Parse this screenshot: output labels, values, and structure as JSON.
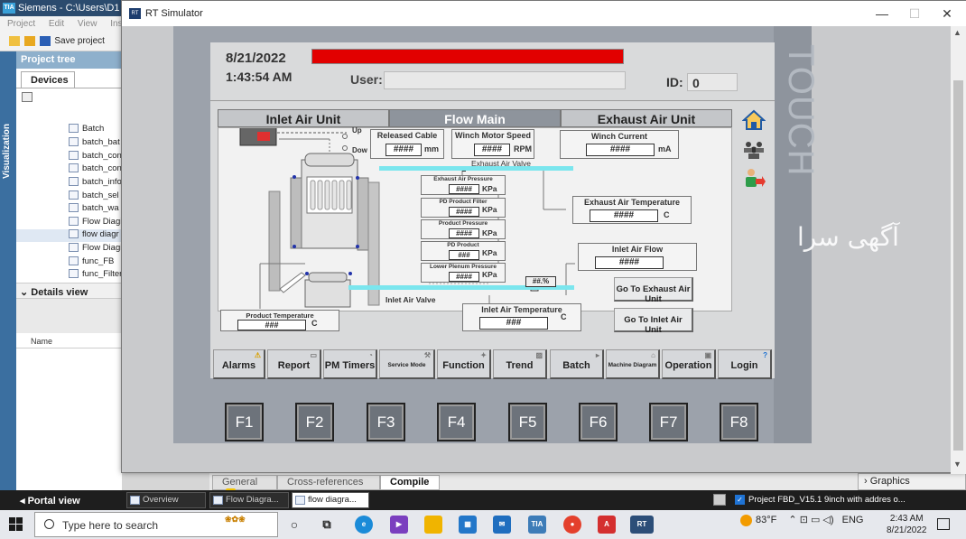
{
  "tia": {
    "title": "Siemens  -  C:\\Users\\D1",
    "menu": [
      "Project",
      "Edit",
      "View",
      "Inse"
    ],
    "save_label": "Save project",
    "side_strip_label": "Visualization",
    "project_tree_header": "Project tree",
    "devices_tab": "Devices",
    "tree_items": [
      "Batch",
      "batch_bat",
      "batch_con",
      "batch_con",
      "batch_info",
      "batch_sel",
      "batch_wa",
      "Flow Diagi",
      "flow diagr",
      "Flow Diagi",
      "func_FB",
      "func_Filter"
    ],
    "selected_tree_item": "flow diagr",
    "details_view": "Details view",
    "name_column": "Name"
  },
  "bottom": {
    "tabs": [
      "General",
      "Cross-references",
      "Compile"
    ],
    "active_tab": "Compile",
    "graphics": "Graphics"
  },
  "portal_bar": {
    "portal_view": "Portal view",
    "tasks": [
      "Overview",
      "Flow Diagra...",
      "flow diagra..."
    ],
    "status": "Project FBD_V15.1 9inch with addres o..."
  },
  "taskbar": {
    "search_placeholder": "Type here to search",
    "temperature": "83°F",
    "language": "ENG",
    "time": "2:43 AM",
    "date": "8/21/2022"
  },
  "rt_window": {
    "title": "RT Simulator",
    "minimize": "—",
    "maximize": "☐",
    "close": "✕"
  },
  "hmi": {
    "brand_vertical": "TOUCH",
    "date": "8/21/2022",
    "time": "1:43:54 AM",
    "user_label": "User:",
    "id_label": "ID:",
    "id_value": "0",
    "unit_tabs": [
      "Inlet Air Unit",
      "Flow Main",
      "Exhaust Air Unit"
    ],
    "active_unit_tab": "Flow Main",
    "diagram": {
      "up_label": "Up",
      "down_label": "Dow",
      "released_cable": {
        "caption": "Released Cable",
        "value": "####",
        "unit": "mm"
      },
      "winch_motor_speed": {
        "caption": "Winch Motor Speed",
        "value": "####",
        "unit": "RPM"
      },
      "winch_current": {
        "caption": "Winch Current",
        "value": "####",
        "unit": "mA"
      },
      "exhaust_air_valve": "Exhaust Air Valve",
      "exhaust_air_pressure": {
        "caption": "Exhaust Air Pressure",
        "value": "####",
        "unit": "KPa"
      },
      "pd_product_filter": {
        "caption": "PD Product Filter",
        "value": "####",
        "unit": "KPa"
      },
      "product_pressure": {
        "caption": "Product Pressure",
        "value": "####",
        "unit": "KPa"
      },
      "pd_product": {
        "caption": "PD Product",
        "value": "###",
        "unit": "KPa"
      },
      "lower_plenum_pressure": {
        "caption": "Lower Plenum Pressure",
        "value": "####",
        "unit": "KPa"
      },
      "exhaust_air_temperature": {
        "caption": "Exhaust Air Temperature",
        "value": "####",
        "unit": "C"
      },
      "inlet_air_flow": {
        "caption": "Inlet Air Flow",
        "value": "####"
      },
      "valve_percent": "##.%",
      "inlet_air_valve": "Inlet Air Valve",
      "product_temperature": {
        "caption": "Product Temperature",
        "value": "###",
        "unit": "C"
      },
      "inlet_air_temperature": {
        "caption": "Inlet Air Temperature",
        "value": "###",
        "unit": "C"
      },
      "go_exhaust": "Go To Exhaust Air Unit",
      "go_inlet": "Go To Inlet Air Unit"
    },
    "function_buttons": [
      "Alarms",
      "Report",
      "PM Timers",
      "Service Mode",
      "Function",
      "Trend",
      "Batch",
      "Machine Diagram",
      "Operation",
      "Login"
    ],
    "f_keys": [
      "F1",
      "F2",
      "F3",
      "F4",
      "F5",
      "F6",
      "F7",
      "F8"
    ]
  },
  "watermark": "آگهی سرا",
  "colors": {
    "alarm_bar": "#e20000",
    "pipe": "#7be6ee",
    "active_tab": "#8e949c"
  }
}
